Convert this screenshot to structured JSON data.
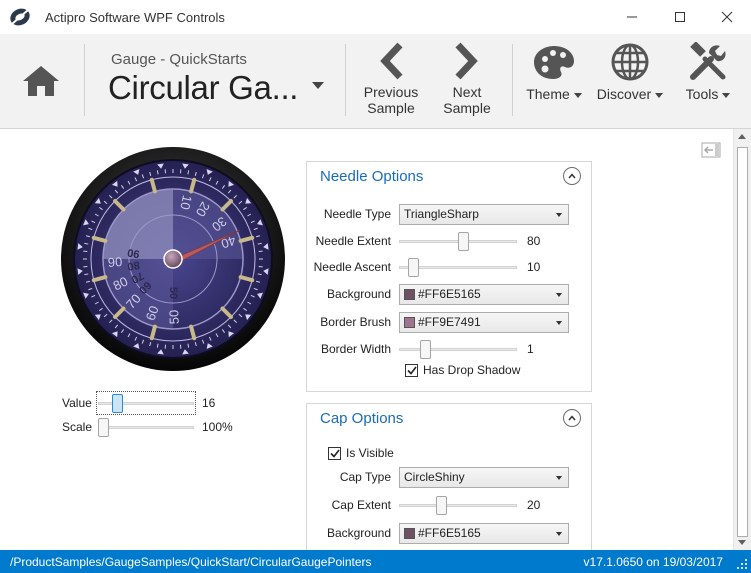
{
  "window": {
    "title": "Actipro Software WPF Controls"
  },
  "header": {
    "breadcrumb_sub": "Gauge - QuickStarts",
    "breadcrumb_main": "Circular Ga...",
    "previous": {
      "line1": "Previous",
      "line2": "Sample"
    },
    "next": {
      "line1": "Next",
      "line2": "Sample"
    },
    "theme": "Theme",
    "discover": "Discover",
    "tools": "Tools"
  },
  "gauge": {
    "outer_labels": [
      "10",
      "20",
      "30",
      "40",
      "50",
      "60",
      "70",
      "80",
      "90"
    ],
    "inner_labels": [
      "10",
      "20",
      "30",
      "40",
      "50",
      "60",
      "70",
      "80",
      "90"
    ],
    "value": 16,
    "needle_color": "#FF6E5165",
    "accent_color": "#b85a5f"
  },
  "controls": {
    "value": {
      "label": "Value",
      "display": "16",
      "fraction": 0.16
    },
    "scale": {
      "label": "Scale",
      "display": "100%",
      "fraction": 0.0
    }
  },
  "needle_options": {
    "title": "Needle Options",
    "needle_type": {
      "label": "Needle Type",
      "value": "TriangleSharp"
    },
    "needle_extent": {
      "label": "Needle Extent",
      "value": "80",
      "fraction": 0.55
    },
    "needle_ascent": {
      "label": "Needle Ascent",
      "value": "10",
      "fraction": 0.08
    },
    "background": {
      "label": "Background",
      "value": "#FF6E5165",
      "swatch": "#6e5165"
    },
    "border_brush": {
      "label": "Border Brush",
      "value": "#FF9E7491",
      "swatch": "#9e7491"
    },
    "border_width": {
      "label": "Border Width",
      "value": "1",
      "fraction": 0.2
    },
    "drop_shadow": {
      "label": "Has Drop Shadow",
      "checked": true
    }
  },
  "cap_options": {
    "title": "Cap Options",
    "is_visible": {
      "label": "Is Visible",
      "checked": true
    },
    "cap_type": {
      "label": "Cap Type",
      "value": "CircleShiny"
    },
    "cap_extent": {
      "label": "Cap Extent",
      "value": "20",
      "fraction": 0.35
    },
    "background": {
      "label": "Background",
      "value": "#FF6E5165",
      "swatch": "#6e5165"
    }
  },
  "status": {
    "path": "/ProductSamples/GaugeSamples/QuickStart/CircularGaugePointers",
    "version": "v17.1.0650 on 19/03/2017"
  }
}
